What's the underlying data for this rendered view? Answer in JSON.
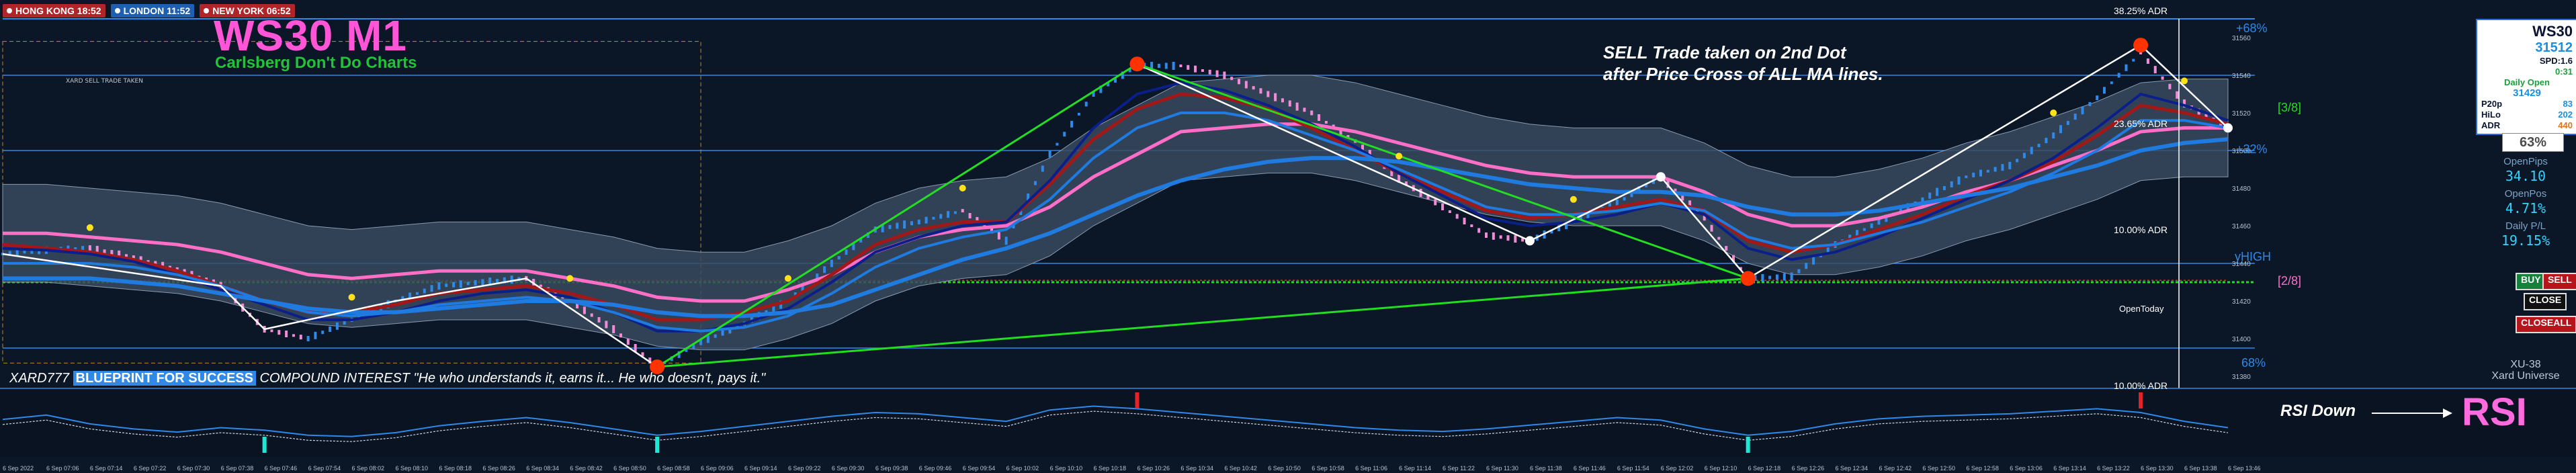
{
  "window": {
    "symbol_tag": "WS30,M1",
    "indicator_tag": "XU-v36-TRADEPX"
  },
  "sessions": [
    {
      "label": "HONG KONG 18:52",
      "color": "#b0252a"
    },
    {
      "label": "LONDON 11:52",
      "color": "#1f5fb0"
    },
    {
      "label": "NEW YORK 06:52",
      "color": "#b0252a"
    }
  ],
  "header": {
    "title": "WS30 M1",
    "subtitle": "Carlsberg Don't Do Charts",
    "small_tag": "XARD SELL TRADE TAKEN"
  },
  "annotation": {
    "line1": "SELL Trade taken on 2nd Dot",
    "line2": "after Price Cross of ALL MA lines."
  },
  "footer": {
    "prefix": "XARD777",
    "blueprint": "BLUEPRINT FOR SUCCESS",
    "rest": "COMPOUND INTEREST \"He who understands it, earns it... He who doesn't, pays it.\""
  },
  "labels": {
    "adr_top": "38.25% ADR",
    "adr_mid": "23.65% ADR",
    "adr_low": "10.00% ADR",
    "adr_rsi": "10.00% ADR",
    "open_today": "OpenToday",
    "pct68p": "+68%",
    "pct32p": "+32%",
    "pct68": "68%",
    "yhigh": "yHIGH",
    "frac38": "[3/8]",
    "frac28": "[2/8]"
  },
  "panel": {
    "symbol": "WS30",
    "price": "31512",
    "spread": "SPD:1.6",
    "timer": "0:31",
    "daily_open_label": "Daily Open",
    "daily_open": "31429",
    "p20p_label": "P20p",
    "p20p": "83",
    "hilo_label": "HiLo",
    "hilo": "202",
    "adr_label": "ADR",
    "adr": "440",
    "percent": "63%",
    "open_pips_label": "OpenPips",
    "open_pips": "34.10",
    "open_pos_label": "OpenPos",
    "open_pos": "4.71%",
    "daily_pl_label": "Daily P/L",
    "daily_pl": "19.15%",
    "buy": "BUY",
    "sell": "SELL",
    "close": "CLOSE",
    "closeall": "CLOSEALL",
    "brand1": "XU-38",
    "brand2": "Xard Universe"
  },
  "rsi": {
    "label": "RSI",
    "down_text": "RSI Down"
  },
  "colors": {
    "bg": "#0b1626",
    "band": "#3a4a5f",
    "up": "#2f89e8",
    "down": "#f28bd6",
    "ma_blue": "#1f7be0",
    "ma_navy": "#0a1f8a",
    "ma_red": "#a01818",
    "ma_pink": "#ff6ec7",
    "green": "#22dd22",
    "white": "#ffffff"
  },
  "chart_data": {
    "type": "line",
    "title": "WS30 M1",
    "y_ticks": [
      "31560",
      "31540",
      "31520",
      "31500",
      "31480",
      "31460",
      "31440",
      "31420",
      "31400",
      "31380"
    ],
    "x_ticks": [
      "6 Sep 2022",
      "6 Sep 07:06",
      "6 Sep 07:14",
      "6 Sep 07:22",
      "6 Sep 07:30",
      "6 Sep 07:38",
      "6 Sep 07:46",
      "6 Sep 07:54",
      "6 Sep 08:02",
      "6 Sep 08:10",
      "6 Sep 08:18",
      "6 Sep 08:26",
      "6 Sep 08:34",
      "6 Sep 08:42",
      "6 Sep 08:50",
      "6 Sep 08:58",
      "6 Sep 09:06",
      "6 Sep 09:14",
      "6 Sep 09:22",
      "6 Sep 09:30",
      "6 Sep 09:38",
      "6 Sep 09:46",
      "6 Sep 09:54",
      "6 Sep 10:02",
      "6 Sep 10:10",
      "6 Sep 10:18",
      "6 Sep 10:26",
      "6 Sep 10:34",
      "6 Sep 10:42",
      "6 Sep 10:50",
      "6 Sep 10:58",
      "6 Sep 11:06",
      "6 Sep 11:14",
      "6 Sep 11:22",
      "6 Sep 11:30",
      "6 Sep 11:38",
      "6 Sep 11:46",
      "6 Sep 11:54",
      "6 Sep 12:02",
      "6 Sep 12:10",
      "6 Sep 12:18",
      "6 Sep 12:26",
      "6 Sep 12:34",
      "6 Sep 12:42",
      "6 Sep 12:50",
      "6 Sep 12:58",
      "6 Sep 13:06",
      "6 Sep 13:14",
      "6 Sep 13:22",
      "6 Sep 13:30",
      "6 Sep 13:38",
      "6 Sep 13:46"
    ],
    "ylim": [
      31380,
      31570
    ],
    "price_path": [
      [
        0,
        31445
      ],
      [
        1,
        31447
      ],
      [
        2,
        31448
      ],
      [
        3,
        31443
      ],
      [
        4,
        31437
      ],
      [
        5,
        31428
      ],
      [
        6,
        31405
      ],
      [
        7,
        31400
      ],
      [
        8,
        31410
      ],
      [
        9,
        31420
      ],
      [
        10,
        31428
      ],
      [
        11,
        31430
      ],
      [
        12,
        31432
      ],
      [
        13,
        31420
      ],
      [
        14,
        31405
      ],
      [
        15,
        31385
      ],
      [
        16,
        31398
      ],
      [
        17,
        31408
      ],
      [
        18,
        31420
      ],
      [
        19,
        31440
      ],
      [
        20,
        31458
      ],
      [
        21,
        31462
      ],
      [
        22,
        31468
      ],
      [
        23,
        31452
      ],
      [
        24,
        31498
      ],
      [
        25,
        31530
      ],
      [
        26,
        31545
      ],
      [
        27,
        31545
      ],
      [
        28,
        31540
      ],
      [
        29,
        31530
      ],
      [
        30,
        31520
      ],
      [
        31,
        31505
      ],
      [
        32,
        31485
      ],
      [
        33,
        31470
      ],
      [
        34,
        31455
      ],
      [
        35,
        31452
      ],
      [
        36,
        31462
      ],
      [
        37,
        31472
      ],
      [
        38,
        31486
      ],
      [
        39,
        31464
      ],
      [
        40,
        31432
      ],
      [
        41,
        31433
      ],
      [
        42,
        31450
      ],
      [
        43,
        31462
      ],
      [
        44,
        31474
      ],
      [
        45,
        31486
      ],
      [
        46,
        31492
      ],
      [
        47,
        31508
      ],
      [
        48,
        31528
      ],
      [
        49,
        31552
      ],
      [
        50,
        31525
      ],
      [
        51,
        31512
      ]
    ],
    "series": [
      {
        "values": [
          31456,
          31456,
          31454,
          31452,
          31450,
          31446,
          31440,
          31434,
          31432,
          31434,
          31436,
          31436,
          31436,
          31432,
          31428,
          31422,
          31420,
          31420,
          31426,
          31434,
          31446,
          31454,
          31458,
          31460,
          31470,
          31486,
          31498,
          31510,
          31512,
          31514,
          31514,
          31510,
          31504,
          31498,
          31492,
          31488,
          31486,
          31486,
          31486,
          31478,
          31466,
          31460,
          31460,
          31464,
          31470,
          31478,
          31484,
          31492,
          31500,
          31510,
          31512,
          31512
        ]
      },
      {
        "values": [
          31450,
          31448,
          31446,
          31442,
          31436,
          31428,
          31420,
          31414,
          31414,
          31418,
          31424,
          31426,
          31428,
          31424,
          31418,
          31410,
          31410,
          31414,
          31420,
          31434,
          31450,
          31458,
          31462,
          31462,
          31482,
          31506,
          31522,
          31530,
          31528,
          31522,
          31512,
          31500,
          31488,
          31478,
          31468,
          31464,
          31466,
          31470,
          31474,
          31468,
          31452,
          31446,
          31450,
          31458,
          31466,
          31476,
          31484,
          31494,
          31508,
          31524,
          31520,
          31514
        ]
      },
      {
        "values": [
          31448,
          31447,
          31445,
          31441,
          31434,
          31426,
          31418,
          31410,
          31410,
          31414,
          31420,
          31424,
          31426,
          31422,
          31414,
          31404,
          31404,
          31408,
          31416,
          31430,
          31446,
          31454,
          31460,
          31462,
          31484,
          31512,
          31530,
          31536,
          31532,
          31524,
          31514,
          31502,
          31488,
          31476,
          31464,
          31460,
          31462,
          31466,
          31472,
          31466,
          31448,
          31442,
          31446,
          31454,
          31464,
          31474,
          31484,
          31496,
          31512,
          31530,
          31524,
          31516
        ]
      },
      {
        "values": [
          31440,
          31440,
          31440,
          31438,
          31434,
          31428,
          31420,
          31414,
          31412,
          31414,
          31418,
          31420,
          31422,
          31420,
          31414,
          31406,
          31404,
          31406,
          31412,
          31424,
          31438,
          31448,
          31454,
          31458,
          31474,
          31496,
          31512,
          31520,
          31520,
          31516,
          31508,
          31500,
          31490,
          31480,
          31470,
          31466,
          31466,
          31468,
          31472,
          31468,
          31454,
          31448,
          31450,
          31456,
          31462,
          31470,
          31478,
          31488,
          31500,
          31516,
          31516,
          31512
        ]
      },
      {
        "values": [
          31432,
          31432,
          31432,
          31430,
          31428,
          31424,
          31420,
          31416,
          31414,
          31414,
          31416,
          31418,
          31420,
          31420,
          31418,
          31414,
          31412,
          31412,
          31414,
          31418,
          31426,
          31434,
          31442,
          31448,
          31456,
          31466,
          31476,
          31484,
          31490,
          31494,
          31496,
          31496,
          31494,
          31490,
          31486,
          31482,
          31480,
          31478,
          31478,
          31476,
          31470,
          31466,
          31466,
          31468,
          31472,
          31476,
          31480,
          31486,
          31492,
          31500,
          31504,
          31506
        ]
      }
    ],
    "rsi_values": [
      55,
      62,
      48,
      40,
      35,
      42,
      38,
      30,
      28,
      34,
      45,
      52,
      58,
      50,
      40,
      30,
      36,
      44,
      52,
      60,
      66,
      64,
      58,
      52,
      70,
      76,
      72,
      66,
      60,
      54,
      48,
      42,
      38,
      36,
      40,
      46,
      52,
      58,
      54,
      40,
      30,
      36,
      48,
      56,
      60,
      62,
      64,
      68,
      72,
      66,
      52,
      42
    ]
  }
}
